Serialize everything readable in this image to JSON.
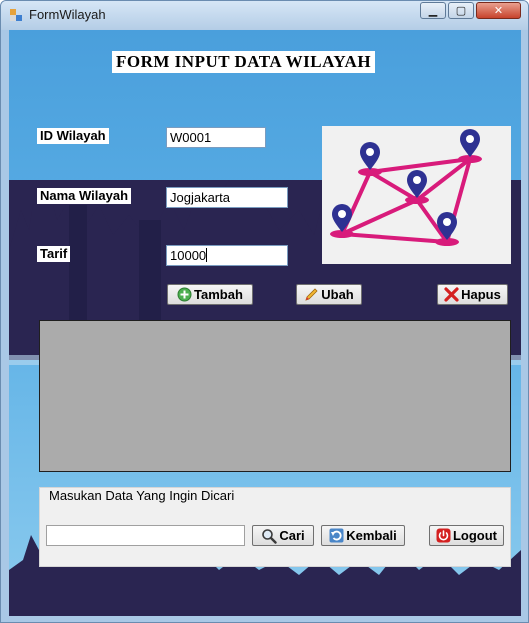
{
  "window": {
    "title": "FormWilayah",
    "min_glyph": "▁",
    "max_glyph": "▢",
    "close_glyph": "✕"
  },
  "form": {
    "heading": "FORM INPUT DATA WILAYAH",
    "id_label": "ID Wilayah",
    "id_value": "W0001",
    "nama_label": "Nama Wilayah",
    "nama_value": "Jogjakarta",
    "tarif_label": "Tarif",
    "tarif_value": "10000"
  },
  "actions": {
    "tambah": "Tambah",
    "ubah": "Ubah",
    "hapus": "Hapus"
  },
  "search": {
    "legend": "Masukan Data Yang Ingin Dicari",
    "value": "",
    "cari": "Cari",
    "kembali": "Kembali",
    "logout": "Logout"
  },
  "icons": {
    "map": "map-pins-icon",
    "tambah": "plus-circle-icon",
    "ubah": "pencil-icon",
    "hapus": "red-x-icon",
    "cari": "magnifier-icon",
    "kembali": "refresh-icon",
    "logout": "power-icon"
  },
  "colors": {
    "map_pink": "#d81b7b",
    "map_pin": "#2e3192",
    "window_border": "#6a8cb0"
  }
}
